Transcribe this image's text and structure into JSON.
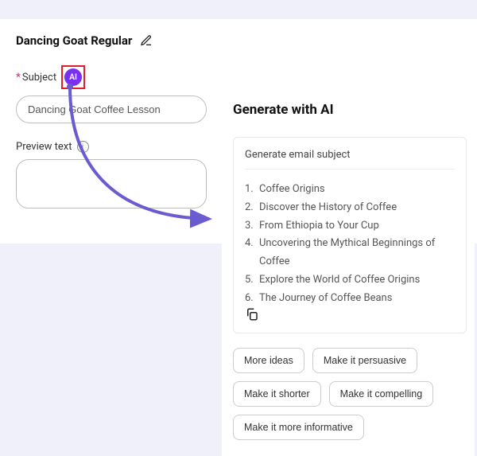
{
  "form": {
    "title": "Dancing Goat Regular",
    "subject_label": "Subject",
    "subject_value": "Dancing Goat Coffee Lesson",
    "ai_badge": "AI",
    "preview_label": "Preview text",
    "preview_value": ""
  },
  "ai": {
    "title": "Generate with AI",
    "card_heading": "Generate email subject",
    "suggestions": [
      "Coffee Origins",
      "Discover the History of Coffee",
      "From Ethiopia to Your Cup",
      "Uncovering the Mythical Beginnings of Coffee",
      "Explore the World of Coffee Origins",
      "The Journey of Coffee Beans"
    ],
    "chips": [
      "More ideas",
      "Make it persuasive",
      "Make it shorter",
      "Make it compelling",
      "Make it more informative"
    ]
  },
  "icons": {
    "edit": "edit-icon",
    "info": "info-icon",
    "copy": "copy-icon"
  },
  "colors": {
    "accent": "#7b2ff2",
    "highlight_border": "#e11d2e",
    "arrow": "#6a5bd0"
  }
}
